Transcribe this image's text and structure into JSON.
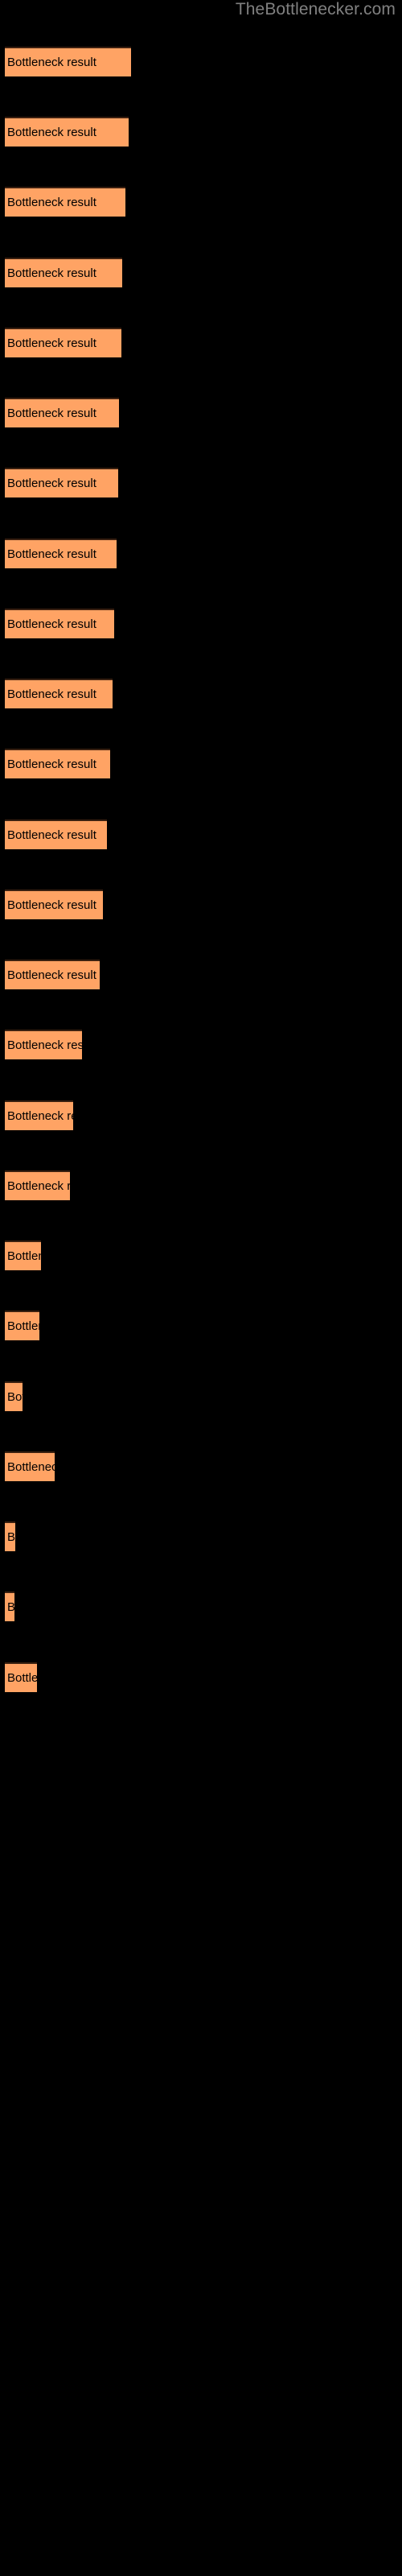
{
  "header": {
    "site_title": "TheBottlenecker.com"
  },
  "colors": {
    "background": "#000000",
    "bar_fill": "#ffa364",
    "bar_border": "#3a2010",
    "bar_label_text": "#000000",
    "title_text": "#808080"
  },
  "chart_data": {
    "type": "bar",
    "orientation": "horizontal",
    "title": "TheBottlenecker.com",
    "xlabel": "",
    "ylabel": "",
    "grid": false,
    "legend": false,
    "axis_visible": false,
    "bar_label_text": "Bottleneck result",
    "categories": [
      "Bottleneck result",
      "Bottleneck result",
      "Bottleneck result",
      "Bottleneck result",
      "Bottleneck result",
      "Bottleneck result",
      "Bottleneck result",
      "Bottleneck result",
      "Bottleneck result",
      "Bottleneck result",
      "Bottleneck result",
      "Bottleneck result",
      "Bottleneck result",
      "Bottleneck result",
      "Bottleneck result",
      "Bottleneck result",
      "Bottleneck result",
      "Bottleneck result",
      "Bottleneck result",
      "Bottleneck result",
      "Bottleneck result",
      "Bottleneck result",
      "Bottleneck result",
      "Bottleneck result"
    ],
    "values": [
      157,
      154,
      150,
      146,
      145,
      142,
      141,
      139,
      136,
      134,
      131,
      127,
      122,
      118,
      96,
      85,
      81,
      45,
      43,
      22,
      62,
      13,
      12,
      40
    ],
    "xlim": [
      0,
      500
    ],
    "bars": [
      {
        "index": 1,
        "label": "Bottleneck result",
        "width": 157,
        "top": 58
      },
      {
        "index": 2,
        "label": "Bottleneck result",
        "width": 154,
        "top": 145
      },
      {
        "index": 3,
        "label": "Bottleneck result",
        "width": 150,
        "top": 232
      },
      {
        "index": 4,
        "label": "Bottleneck result",
        "width": 146,
        "top": 320
      },
      {
        "index": 5,
        "label": "Bottleneck result",
        "width": 145,
        "top": 407
      },
      {
        "index": 6,
        "label": "Bottleneck result",
        "width": 142,
        "top": 494
      },
      {
        "index": 7,
        "label": "Bottleneck result",
        "width": 141,
        "top": 581
      },
      {
        "index": 8,
        "label": "Bottleneck result",
        "width": 139,
        "top": 669
      },
      {
        "index": 9,
        "label": "Bottleneck result",
        "width": 136,
        "top": 756
      },
      {
        "index": 10,
        "label": "Bottleneck result",
        "width": 134,
        "top": 843
      },
      {
        "index": 11,
        "label": "Bottleneck result",
        "width": 131,
        "top": 930
      },
      {
        "index": 12,
        "label": "Bottleneck result",
        "width": 127,
        "top": 1018
      },
      {
        "index": 13,
        "label": "Bottleneck result",
        "width": 122,
        "top": 1105
      },
      {
        "index": 14,
        "label": "Bottleneck result",
        "width": 118,
        "top": 1192
      },
      {
        "index": 15,
        "label": "Bottleneck result",
        "width": 96,
        "top": 1279
      },
      {
        "index": 16,
        "label": "Bottleneck result",
        "width": 85,
        "top": 1367
      },
      {
        "index": 17,
        "label": "Bottleneck result",
        "width": 81,
        "top": 1454
      },
      {
        "index": 18,
        "label": "Bottleneck result",
        "width": 45,
        "top": 1541
      },
      {
        "index": 19,
        "label": "Bottleneck result",
        "width": 43,
        "top": 1628
      },
      {
        "index": 20,
        "label": "Bottleneck result",
        "width": 22,
        "top": 1716
      },
      {
        "index": 21,
        "label": "Bottleneck result",
        "width": 62,
        "top": 1803
      },
      {
        "index": 22,
        "label": "Bottleneck result",
        "width": 13,
        "top": 1890
      },
      {
        "index": 23,
        "label": "Bottleneck result",
        "width": 12,
        "top": 1977
      },
      {
        "index": 24,
        "label": "Bottleneck result",
        "width": 40,
        "top": 2065
      }
    ]
  }
}
